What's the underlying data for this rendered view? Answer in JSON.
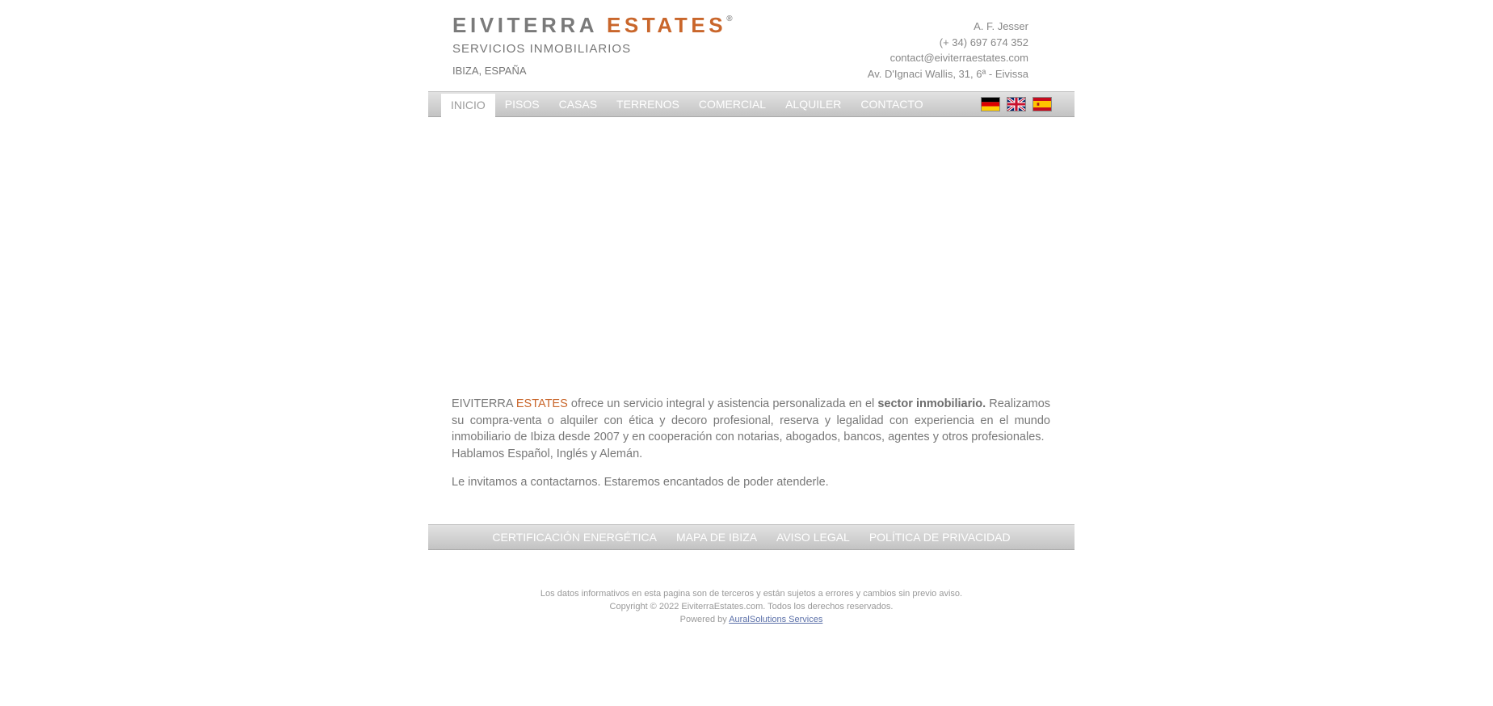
{
  "brand": {
    "name_part1": "EIVITERRA",
    "name_part2": "ESTATES",
    "registered": "®",
    "tagline": "SERVICIOS INMOBILIARIOS",
    "location": "IBIZA, ESPAÑA",
    "accent_color": "#c9662b"
  },
  "contact": {
    "name": "A. F. Jesser",
    "phone": "(+ 34) 697 674 352",
    "email": "contact@eiviterraestates.com",
    "address": "Av. D'Ignaci Wallis, 31, 6ª - Eivissa"
  },
  "nav": {
    "items": [
      {
        "label": "INICIO",
        "active": true
      },
      {
        "label": "PISOS"
      },
      {
        "label": "CASAS"
      },
      {
        "label": "TERRENOS"
      },
      {
        "label": "COMERCIAL"
      },
      {
        "label": "ALQUILER"
      },
      {
        "label": "CONTACTO"
      }
    ],
    "flags": [
      {
        "icon": "germany-flag-icon"
      },
      {
        "icon": "uk-flag-icon"
      },
      {
        "icon": "spain-flag-icon"
      }
    ]
  },
  "content": {
    "intro_brand1": "EIVITERRA",
    "intro_brand2": "ESTATES",
    "intro_text1": " ofrece un servicio integral y asistencia personalizada en el ",
    "intro_bold": "sector inmobiliario.",
    "intro_text2": " Realizamos su compra-venta o alquiler con ética y decoro profesional, reserva y legalidad con experiencia en el mundo inmobiliario de Ibiza desde 2007 y en cooperación con notarias, abogados, bancos, agentes y otros profesionales.",
    "languages": "Hablamos Español, Inglés y  Alemán.",
    "invite": "Le invitamos a contactarnos. Estaremos encantados de poder atenderle."
  },
  "footer_nav": {
    "items": [
      {
        "label": "CERTIFICACIÓN ENERGÉTICA"
      },
      {
        "label": "MAPA DE IBIZA"
      },
      {
        "label": "AVISO LEGAL"
      },
      {
        "label": "POLÍTICA DE PRIVACIDAD"
      }
    ]
  },
  "legal": {
    "disclaimer": "Los datos informativos en esta pagina son de terceros y están sujetos a errores y cambios sin previo aviso.",
    "copyright": "Copyright © 2022 EiviterraEstates.com. Todos los derechos reservados.",
    "powered_prefix": "Powered by ",
    "powered_link": "AuralSolutions Services"
  }
}
